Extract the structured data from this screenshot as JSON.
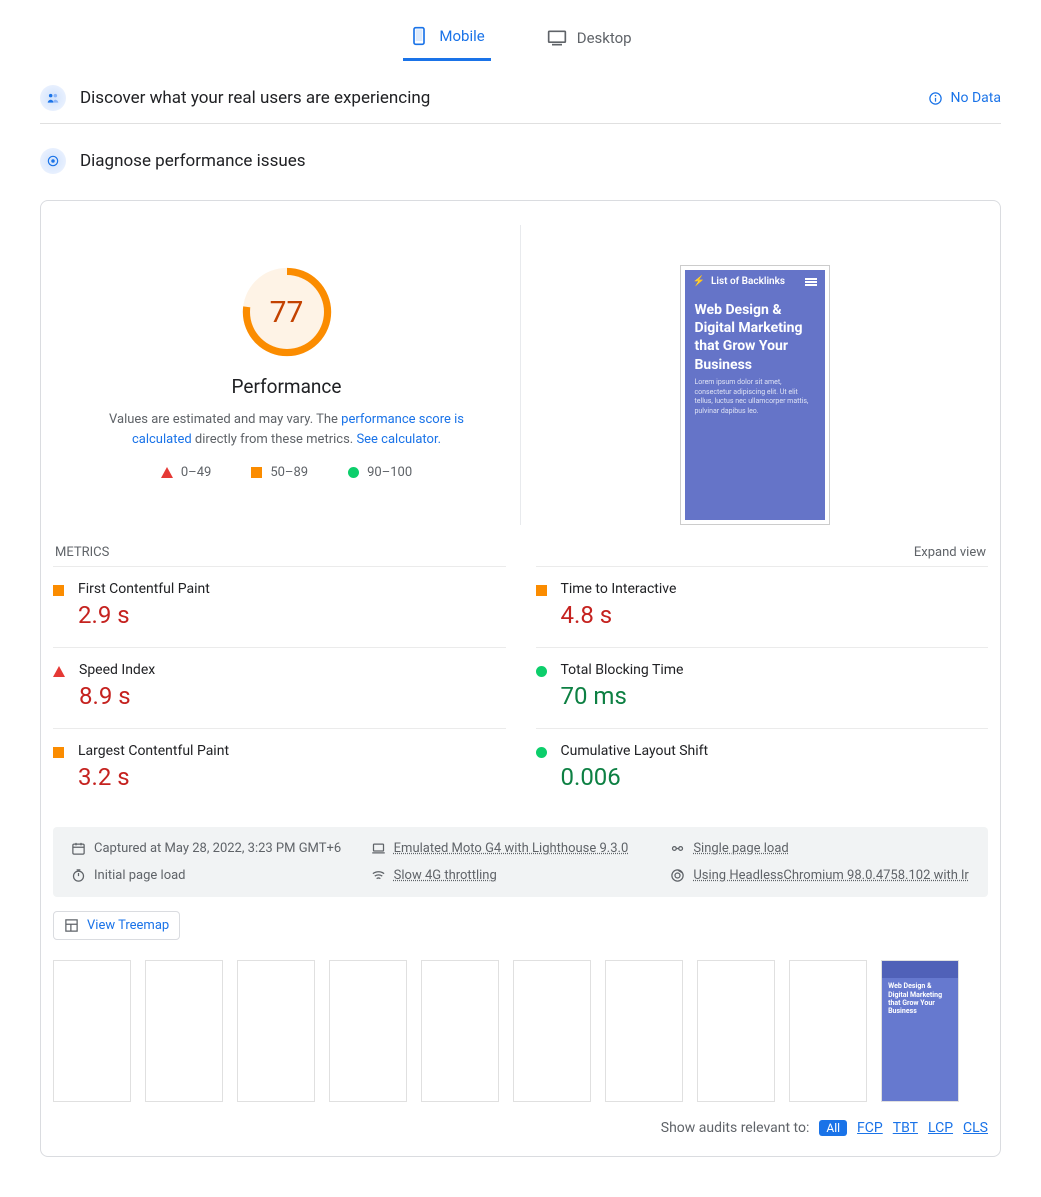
{
  "tabs": {
    "mobile": "Mobile",
    "desktop": "Desktop"
  },
  "discover": {
    "title": "Discover what your real users are experiencing",
    "nodata": "No Data"
  },
  "diagnose": {
    "title": "Diagnose performance issues"
  },
  "gauge": {
    "score": "77",
    "label": "Performance",
    "note_pre": "Values are estimated and may vary. The ",
    "note_link1": "performance score is calculated",
    "note_mid": " directly from these metrics. ",
    "note_link2": "See calculator.",
    "legend_low": "0–49",
    "legend_mid": "50–89",
    "legend_high": "90–100"
  },
  "preview": {
    "brand": "List of Backlinks",
    "headline": "Web Design & Digital Marketing that Grow Your Business",
    "lorem": "Lorem ipsum dolor sit amet, consectetur adipiscing elit. Ut elit tellus, luctus nec ullamcorper mattis, pulvinar dapibus leo."
  },
  "metrics": {
    "title": "METRICS",
    "expand": "Expand view",
    "rows": [
      {
        "ind": "orange",
        "label": "First Contentful Paint",
        "val": "2.9 s",
        "cls": "red"
      },
      {
        "ind": "orange",
        "label": "Time to Interactive",
        "val": "4.8 s",
        "cls": "red"
      },
      {
        "ind": "red",
        "label": "Speed Index",
        "val": "8.9 s",
        "cls": "red"
      },
      {
        "ind": "green",
        "label": "Total Blocking Time",
        "val": "70 ms",
        "cls": "green"
      },
      {
        "ind": "orange",
        "label": "Largest Contentful Paint",
        "val": "3.2 s",
        "cls": "red"
      },
      {
        "ind": "green",
        "label": "Cumulative Layout Shift",
        "val": "0.006",
        "cls": "green"
      }
    ]
  },
  "env": {
    "captured": "Captured at May 28, 2022, 3:23 PM GMT+6",
    "emulated": "Emulated Moto G4 with Lighthouse 9.3.0",
    "single": "Single page load",
    "initial": "Initial page load",
    "throttle": "Slow 4G throttling",
    "chromium": "Using HeadlessChromium 98.0.4758.102 with lr"
  },
  "treemap": "View Treemap",
  "audits": {
    "prompt": "Show audits relevant to:",
    "all": "All",
    "fcp": "FCP",
    "tbt": "TBT",
    "lcp": "LCP",
    "cls": "CLS"
  }
}
